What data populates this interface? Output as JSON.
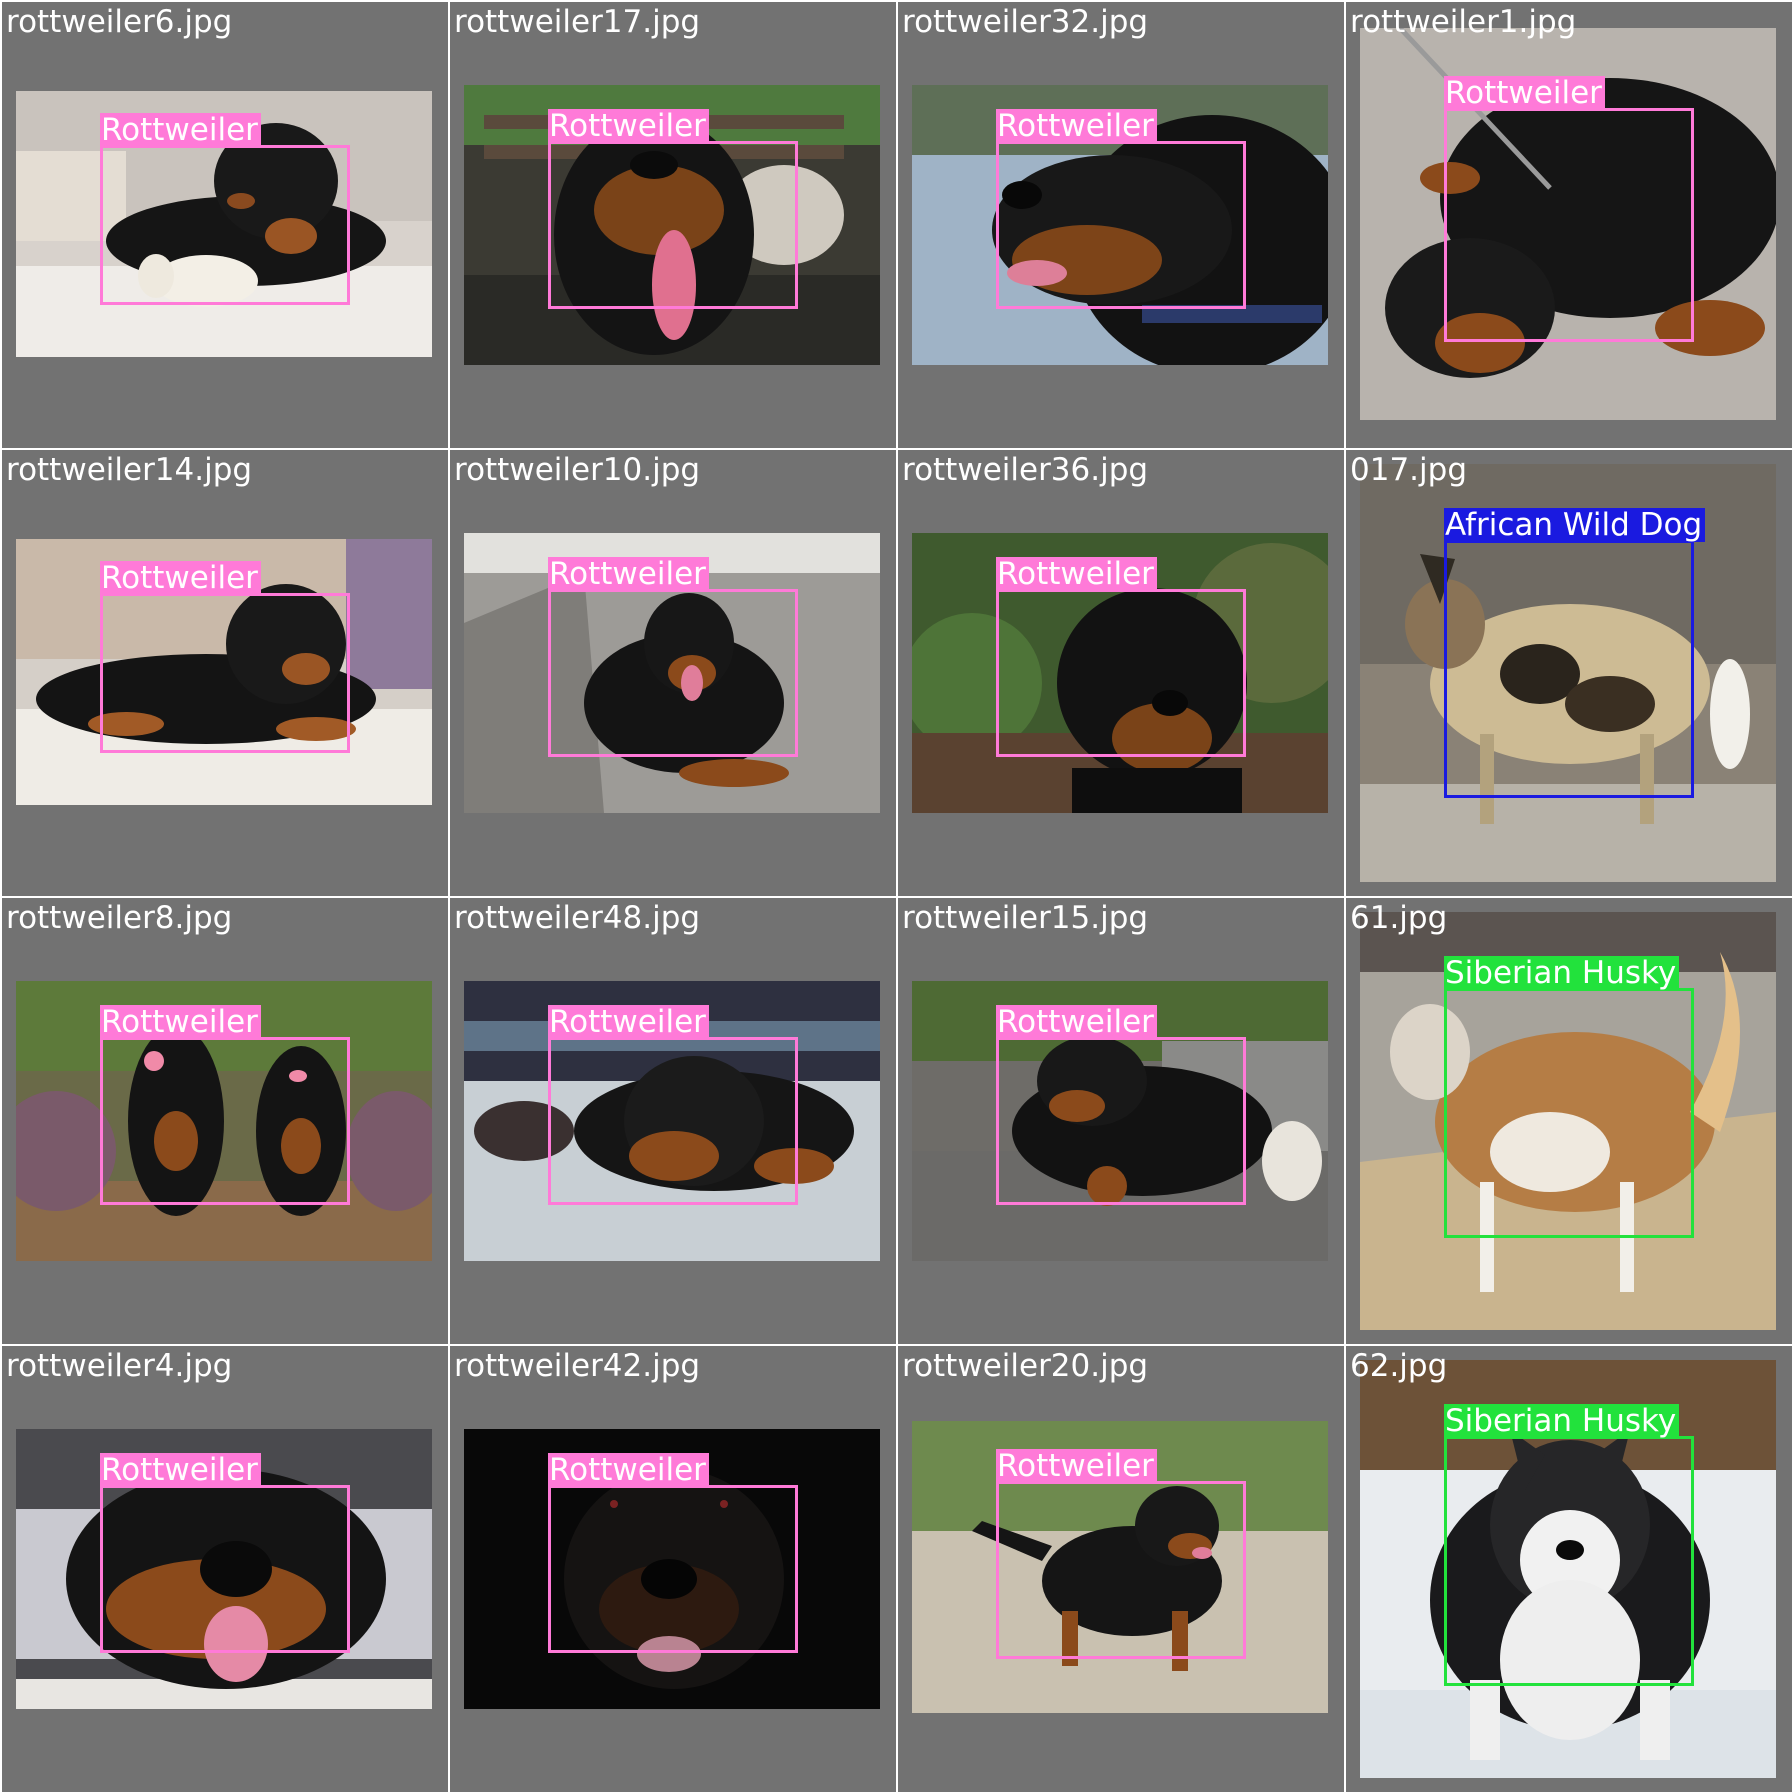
{
  "colors": {
    "rottweiler": "#ff7ad8",
    "african_wild_dog": "#1a1ae0",
    "siberian_husky": "#22e23c",
    "tile_background": "#727272"
  },
  "tiles": [
    {
      "file": "rottweiler6.jpg",
      "label": "Rottweiler",
      "class": "rottweiler",
      "scene": "puppy-with-bone"
    },
    {
      "file": "rottweiler17.jpg",
      "label": "Rottweiler",
      "class": "rottweiler",
      "scene": "dog-tongue-out-park"
    },
    {
      "file": "rottweiler32.jpg",
      "label": "Rottweiler",
      "class": "rottweiler",
      "scene": "dog-head-profile"
    },
    {
      "file": "rottweiler1.jpg",
      "label": "Rottweiler",
      "class": "rottweiler",
      "scene": "dog-lying-on-pavement"
    },
    {
      "file": "rottweiler14.jpg",
      "label": "Rottweiler",
      "class": "rottweiler",
      "scene": "puppy-lying"
    },
    {
      "file": "rottweiler10.jpg",
      "label": "Rottweiler",
      "class": "rottweiler",
      "scene": "dog-lying-on-road"
    },
    {
      "file": "rottweiler36.jpg",
      "label": "Rottweiler",
      "class": "rottweiler",
      "scene": "dog-head-garden"
    },
    {
      "file": "017.jpg",
      "label": "African Wild Dog",
      "class": "african_wild_dog",
      "scene": "wild-dog-on-rocks"
    },
    {
      "file": "rottweiler8.jpg",
      "label": "Rottweiler",
      "class": "rottweiler",
      "scene": "two-dogs-sitting"
    },
    {
      "file": "rottweiler48.jpg",
      "label": "Rottweiler",
      "class": "rottweiler",
      "scene": "puppy-on-floor"
    },
    {
      "file": "rottweiler15.jpg",
      "label": "Rottweiler",
      "class": "rottweiler",
      "scene": "dog-on-sofa"
    },
    {
      "file": "61.jpg",
      "label": "Siberian Husky",
      "class": "siberian_husky",
      "scene": "husky-standing"
    },
    {
      "file": "rottweiler4.jpg",
      "label": "Rottweiler",
      "class": "rottweiler",
      "scene": "dog-face-closeup"
    },
    {
      "file": "rottweiler42.jpg",
      "label": "Rottweiler",
      "class": "rottweiler",
      "scene": "dog-in-dark"
    },
    {
      "file": "rottweiler20.jpg",
      "label": "Rottweiler",
      "class": "rottweiler",
      "scene": "puppy-walking-grass"
    },
    {
      "file": "62.jpg",
      "label": "Siberian Husky",
      "class": "siberian_husky",
      "scene": "husky-in-snow"
    }
  ]
}
